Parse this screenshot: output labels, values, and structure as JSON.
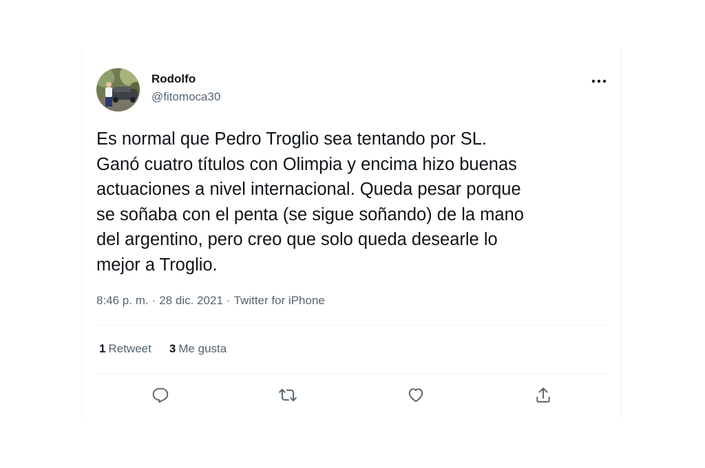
{
  "tweet": {
    "display_name": "Rodolfo",
    "handle": "@fitomoca30",
    "text": "Es normal que Pedro Troglio sea tentando por SL.\nGanó cuatro títulos con Olimpia y encima hizo buenas\nactuaciones a nivel internacional. Queda pesar porque\nse soñaba con el penta (se sigue soñando) de la mano\ndel argentino, pero creo que solo queda desearle lo\nmejor a Troglio.",
    "time": "8:46 p. m.",
    "separator": "·",
    "date": "28 dic. 2021",
    "source": "Twitter for iPhone"
  },
  "stats": {
    "retweets_count": "1",
    "retweets_label": "Retweet",
    "likes_count": "3",
    "likes_label": "Me gusta"
  },
  "icons": {
    "more": "more-horizontal-icon",
    "reply": "reply-icon",
    "retweet": "retweet-icon",
    "like": "heart-icon",
    "share": "share-icon"
  },
  "colors": {
    "text_primary": "#0f1419",
    "text_secondary": "#536471",
    "divider": "#eff3f4"
  }
}
